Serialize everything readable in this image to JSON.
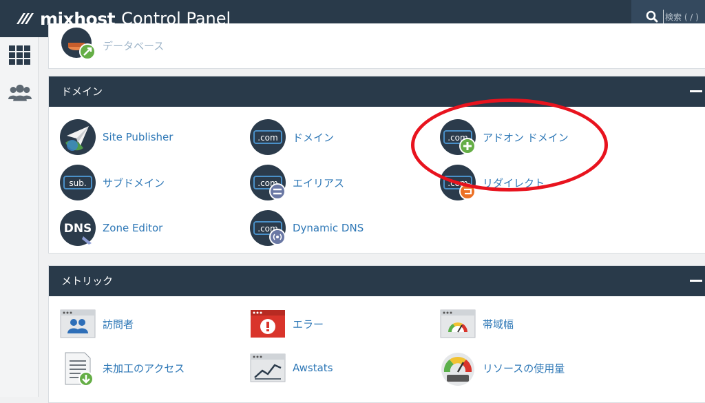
{
  "header": {
    "brand": "mixhost",
    "title": "Control Panel"
  },
  "search": {
    "placeholder": "検索 ( / )"
  },
  "sidebar": {
    "items": [
      {
        "icon": "grid-icon"
      },
      {
        "icon": "users-icon"
      }
    ]
  },
  "partial_top_item": {
    "label": "データベース"
  },
  "domain_section": {
    "title": "ドメイン",
    "items": [
      {
        "label": "Site Publisher",
        "icon": "paper-plane-globe-icon"
      },
      {
        "label": "ドメイン",
        "icon": "dotcom-icon"
      },
      {
        "label": "アドオン ドメイン",
        "icon": "dotcom-add-icon"
      },
      {
        "label": "サブドメイン",
        "icon": "sub-icon"
      },
      {
        "label": "エイリアス",
        "icon": "dotcom-alias-icon"
      },
      {
        "label": "リダイレクト",
        "icon": "dotcom-redirect-icon"
      },
      {
        "label": "Zone Editor",
        "icon": "dns-icon"
      },
      {
        "label": "Dynamic DNS",
        "icon": "dotcom-dynamic-icon"
      }
    ]
  },
  "metrics_section": {
    "title": "メトリック",
    "items": [
      {
        "label": "訪問者",
        "icon": "visitors-icon"
      },
      {
        "label": "エラー",
        "icon": "error-icon"
      },
      {
        "label": "帯域幅",
        "icon": "gauge-icon"
      },
      {
        "label": "未加工のアクセス",
        "icon": "raw-access-icon"
      },
      {
        "label": "Awstats",
        "icon": "chart-icon"
      },
      {
        "label": "リソースの使用量",
        "icon": "resource-usage-icon"
      }
    ]
  },
  "colors": {
    "header": "#293a4a",
    "link": "#2d77b6",
    "annotation": "#e8131e"
  }
}
